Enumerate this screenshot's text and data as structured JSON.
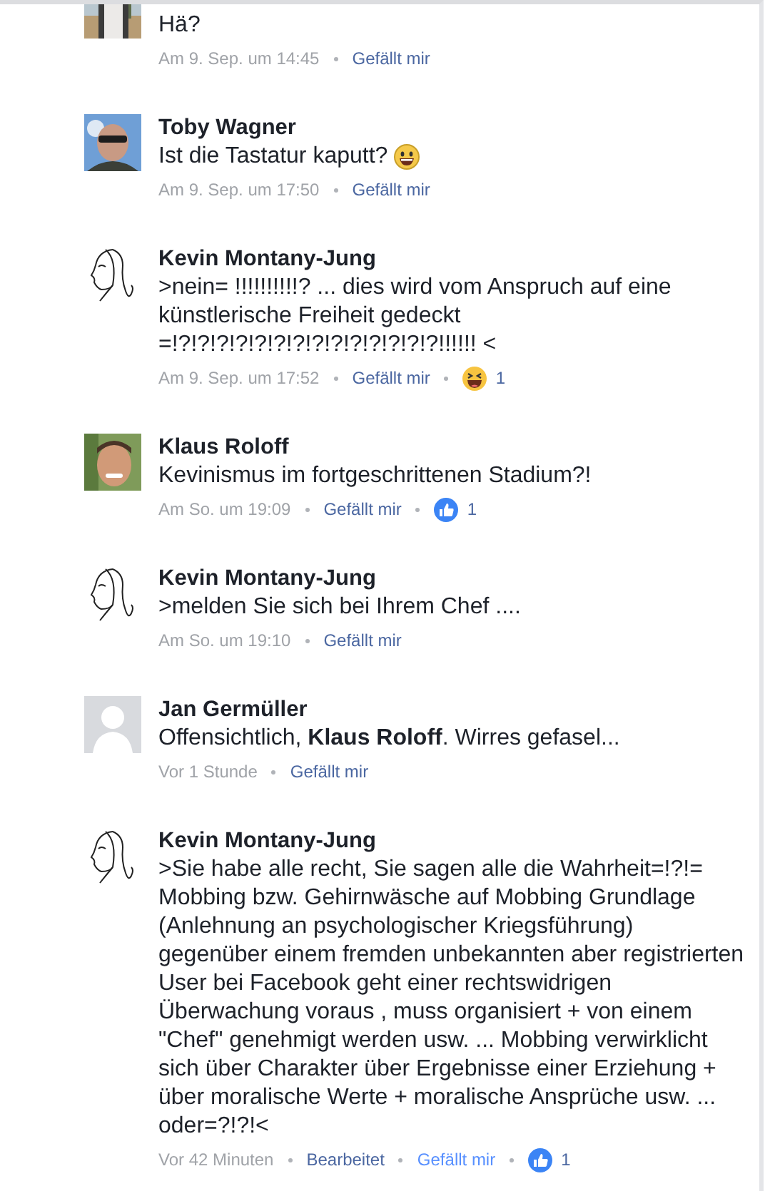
{
  "comments": [
    {
      "avatar": {
        "kind": "photo-beach"
      },
      "body": "Hä?",
      "time": "Am 9. Sep. um 14:45",
      "like_label": "Gefällt mir",
      "liked": false
    },
    {
      "avatar": {
        "kind": "photo-sky"
      },
      "name": "Toby Wagner",
      "body": "Ist die Tastatur kaputt?",
      "body_emoji": {
        "kind": "smile"
      },
      "time": "Am 9. Sep. um 17:50",
      "like_label": "Gefällt mir",
      "liked": false
    },
    {
      "avatar": {
        "kind": "sketch"
      },
      "name": "Kevin Montany-Jung",
      "body": ">nein= !!!!!!!!!!? ... dies wird vom Anspruch auf eine künstlerische Freiheit gedeckt =!?!?!?!?!?!?!?!?!?!?!?!?!?!?!!!!!! <",
      "time": "Am 9. Sep. um 17:52",
      "like_label": "Gefällt mir",
      "liked": false,
      "reaction": {
        "kind": "haha",
        "count": "1"
      }
    },
    {
      "avatar": {
        "kind": "photo-face"
      },
      "name": "Klaus Roloff",
      "body": "Kevinismus im fortgeschrittenen Stadium?!",
      "time": "Am So. um 19:09",
      "like_label": "Gefällt mir",
      "liked": false,
      "reaction": {
        "kind": "like",
        "count": "1"
      }
    },
    {
      "avatar": {
        "kind": "sketch"
      },
      "name": "Kevin Montany-Jung",
      "body": ">melden Sie sich bei Ihrem Chef ....",
      "time": "Am So. um 19:10",
      "like_label": "Gefällt mir",
      "liked": false
    },
    {
      "avatar": {
        "kind": "default"
      },
      "name": "Jan Germüller",
      "body": "Offensichtlich, **Klaus Roloff**. Wirres gefasel...",
      "time": "Vor 1 Stunde",
      "like_label": "Gefällt mir",
      "liked": false
    },
    {
      "avatar": {
        "kind": "sketch"
      },
      "name": "Kevin Montany-Jung",
      "body": ">Sie habe alle recht, Sie sagen alle die Wahrheit=!?!= Mobbing bzw. Gehirnwäsche auf Mobbing Grundlage (Anlehnung an psychologischer Kriegsführung) gegenüber einem fremden unbekannten aber registrierten User  bei Facebook geht einer rechtswidrigen Überwachung voraus , muss organisiert + von einem \"Chef\" genehmigt werden usw. ... Mobbing verwirklicht sich über Charakter über Ergebnisse einer Erziehung + über moralische Werte + moralische Ansprüche usw. ... oder=?!?!<",
      "time": "Vor 42 Minuten",
      "edited": "Bearbeitet",
      "like_label": "Gefällt mir",
      "liked": true,
      "reaction": {
        "kind": "like",
        "count": "1"
      }
    }
  ]
}
